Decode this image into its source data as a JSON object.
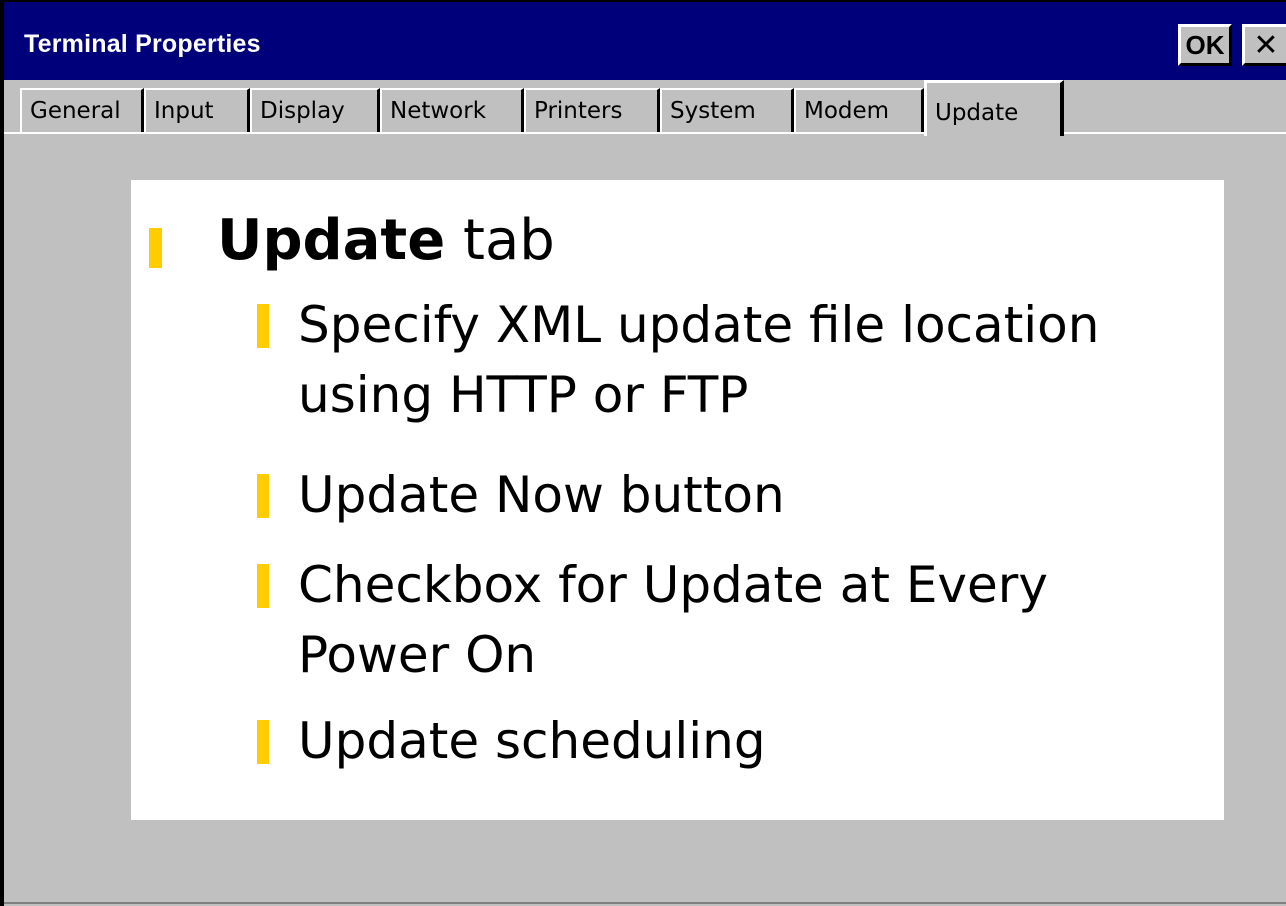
{
  "window": {
    "title": "Terminal Properties",
    "ok_label": "OK",
    "close_label": "✕"
  },
  "tabs": [
    {
      "label": "General"
    },
    {
      "label": "Input"
    },
    {
      "label": "Display"
    },
    {
      "label": "Network"
    },
    {
      "label": "Printers"
    },
    {
      "label": "System"
    },
    {
      "label": "Modem"
    },
    {
      "label": "Update",
      "active": true
    }
  ],
  "slide": {
    "heading_bold": "Update",
    "heading_rest": " tab",
    "items": [
      {
        "line1": "Specify XML update file location",
        "line2": "using HTTP or FTP"
      },
      {
        "line1": "Update Now button"
      },
      {
        "line1": "Checkbox for Update at Every",
        "line2": "Power On"
      },
      {
        "line1": "Update scheduling"
      }
    ]
  },
  "colors": {
    "titlebar": "#00007b",
    "face": "#c0c0c0",
    "bullet": "#ffcc00"
  }
}
